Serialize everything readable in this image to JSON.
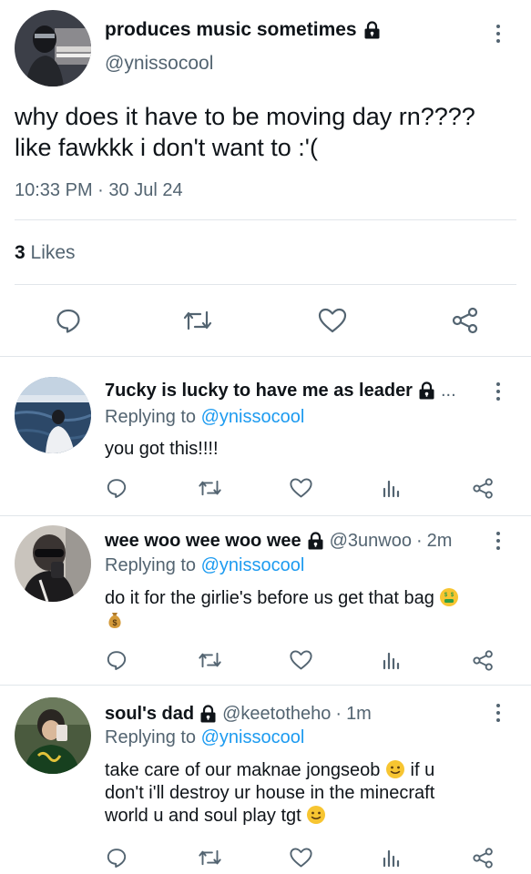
{
  "main_tweet": {
    "display_name": "produces music sometimes",
    "handle": "@ynissocool",
    "text_line1": "why does it have to be moving day rn????",
    "text_line2": "like fawkkk i don't want to :'(",
    "time": "10:33 PM",
    "date_sep": "·",
    "date": "30 Jul 24",
    "likes_count": "3",
    "likes_label": "Likes",
    "icons": [
      "comment-icon",
      "retweet-icon",
      "heart-icon",
      "share-icon"
    ]
  },
  "replies": [
    {
      "display_name": "7ucky is lucky to have me as leader",
      "truncation": "...",
      "handle": "",
      "time": "",
      "replying_prefix": "Replying to",
      "replying_to": "@ynissocool",
      "text": "you got this!!!!"
    },
    {
      "display_name": "wee woo wee woo wee",
      "handle": "@3unwoo",
      "time_sep": "·",
      "time": "2m",
      "replying_prefix": "Replying to",
      "replying_to": "@ynissocool",
      "text": "do it for the girlie's before us get that bag",
      "emojis": [
        "money-mouth-face-emoji",
        "money-bag-emoji"
      ]
    },
    {
      "display_name": "soul's dad",
      "handle": "@keetotheho",
      "time_sep": "·",
      "time": "1m",
      "replying_prefix": "Replying to",
      "replying_to": "@ynissocool",
      "text_part1": "take care of our maknae jongseob",
      "text_part2": "if u",
      "text_line2": "don't i'll destroy ur house in the minecraft",
      "text_line3": "world u and soul play tgt",
      "emojis": [
        "slightly-smiling-face-emoji",
        "slightly-smiling-face-emoji"
      ]
    }
  ],
  "colors": {
    "text": "#0f1419",
    "secondary": "#536471",
    "link": "#1d9bf0",
    "divider": "#e1e6ea"
  }
}
